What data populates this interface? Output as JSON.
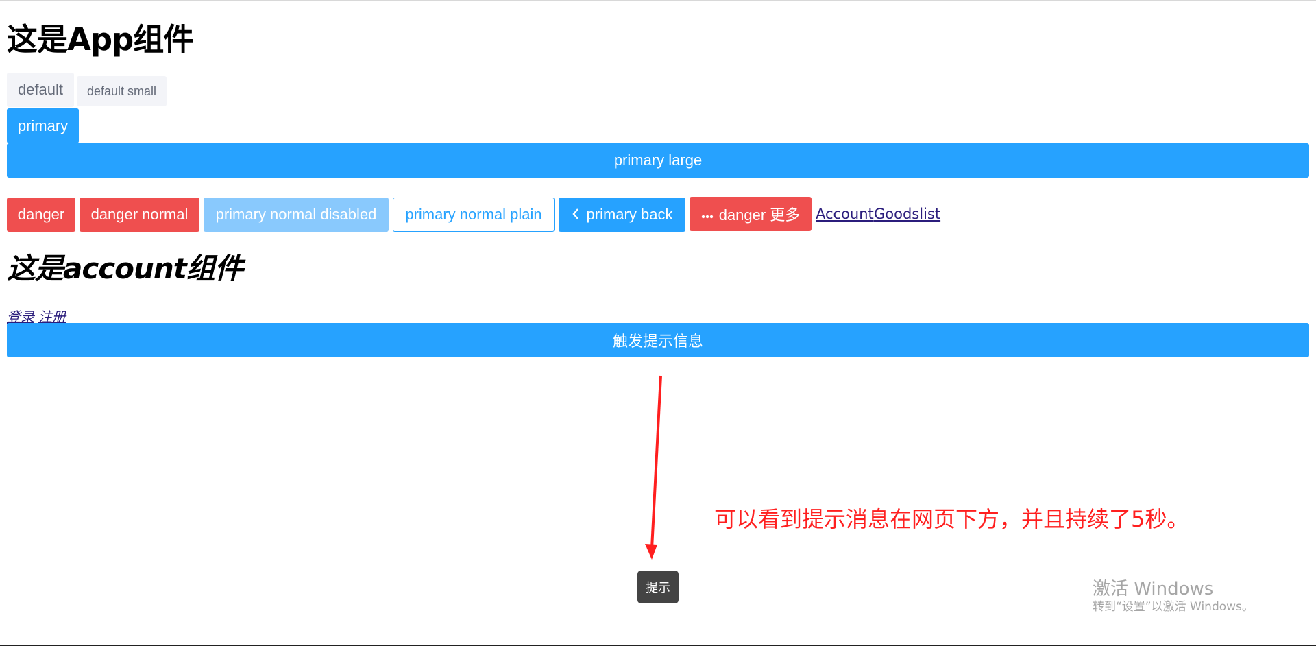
{
  "app": {
    "title": "这是App组件",
    "buttons": {
      "default": "default",
      "default_small": "default small",
      "primary": "primary",
      "primary_large": "primary large",
      "danger": "danger",
      "danger_normal": "danger normal",
      "primary_normal_disabled": "primary normal disabled",
      "primary_normal_plain": "primary normal plain",
      "primary_back": "primary back",
      "danger_more": "danger 更多"
    },
    "links": {
      "account": "Account",
      "goodslist": "Goodslist"
    }
  },
  "account": {
    "title": "这是account组件",
    "login_link": "登录",
    "register_link": "注册",
    "trigger_button": "触发提示信息"
  },
  "toast": {
    "text": "提示"
  },
  "annotation": {
    "text": "可以看到提示消息在网页下方，并且持续了5秒。",
    "color": "#ff1f1f"
  },
  "watermark": {
    "title": "激活 Windows",
    "subtitle": "转到“设置”以激活 Windows。"
  },
  "colors": {
    "primary": "#26a2ff",
    "danger": "#ef4f4f",
    "disabled": "#89c9fd",
    "default_bg": "#f3f4f8"
  }
}
